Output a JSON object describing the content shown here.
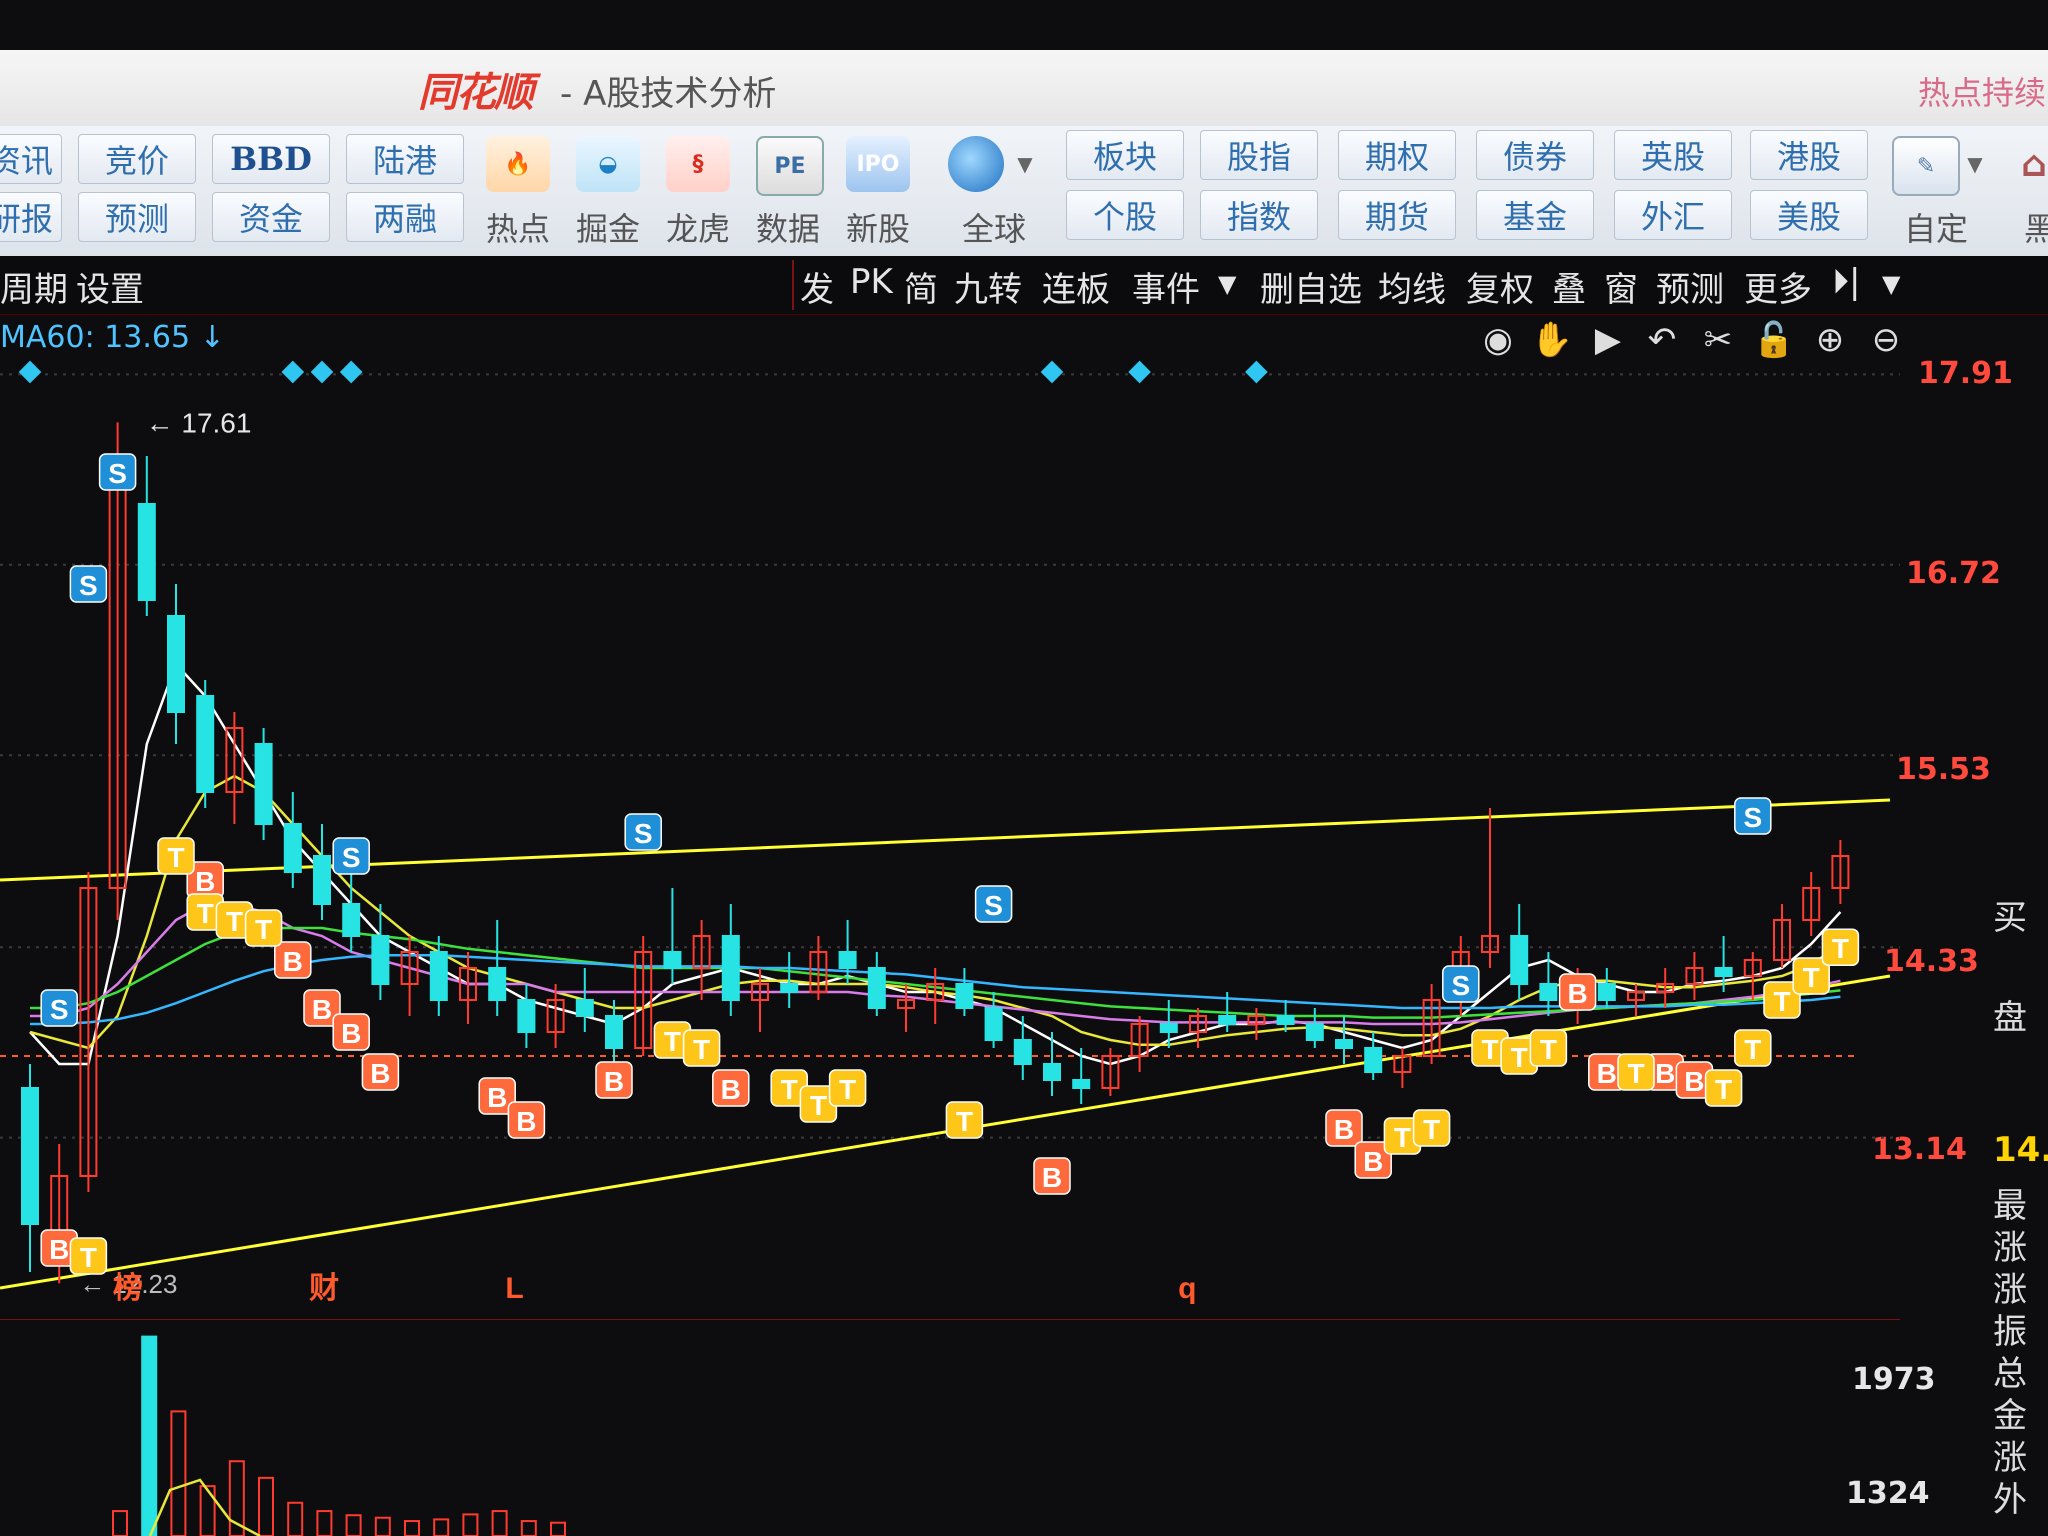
{
  "window": {
    "app_name": "同花顺",
    "title": "- A股技术分析",
    "hot_text": "热点持续"
  },
  "toolbar": {
    "top_row": [
      "资讯",
      "竞价",
      "BBD",
      "陆港"
    ],
    "bottom_row": [
      "研报",
      "预测",
      "资金",
      "两融"
    ],
    "icons": [
      {
        "label": "热点",
        "icon": "flame-icon"
      },
      {
        "label": "掘金",
        "icon": "gold-basket-icon"
      },
      {
        "label": "龙虎",
        "icon": "dragon-icon"
      },
      {
        "label": "数据",
        "icon": "pe-icon"
      },
      {
        "label": "新股",
        "icon": "ipo-icon"
      },
      {
        "label": "全球",
        "icon": "globe-icon"
      }
    ],
    "market_top": [
      "板块",
      "股指",
      "期权",
      "债券",
      "英股",
      "港股"
    ],
    "market_bottom": [
      "个股",
      "指数",
      "期货",
      "基金",
      "外汇",
      "美股"
    ],
    "custom_label": "自定",
    "more_label": "黑"
  },
  "chart_toolbar": {
    "left": [
      "周期",
      "设置"
    ],
    "right": [
      "发",
      "PK",
      "简",
      "九转",
      "连板",
      "事件",
      "删自选",
      "均线",
      "复权",
      "叠",
      "窗",
      "预测",
      "更多"
    ]
  },
  "ma_readout": "MA60: 13.65",
  "price_axis": [
    "17.91",
    "16.72",
    "15.53",
    "14.33",
    "13.14"
  ],
  "volume_axis": [
    "1973",
    "1324"
  ],
  "annotations": {
    "high": "17.61",
    "low": "12.23",
    "events": [
      "榜",
      "财",
      "L",
      "q"
    ]
  },
  "right_panel": {
    "labels": [
      "买",
      "盘",
      "14.",
      "最",
      "涨",
      "涨",
      "振",
      "总",
      "金",
      "涨",
      "外"
    ]
  },
  "colors": {
    "up": "#ff3b2f",
    "down": "#27e3e3",
    "trend_line": "#ffff33",
    "ma_white": "#ffffff",
    "ma_yellow": "#e8e83a",
    "ma_purple": "#d77ce8",
    "ma_green": "#3ee03e",
    "ma_blue": "#35b7ff",
    "b_marker": "#ff6a3d",
    "t_marker": "#ffc61a",
    "s_marker": "#1f8fd8"
  },
  "chart_data": {
    "type": "candlestick",
    "ylim": [
      12.0,
      18.0
    ],
    "candles": [
      [
        13.45,
        13.6,
        12.3,
        12.6
      ],
      [
        12.55,
        13.1,
        12.23,
        12.9
      ],
      [
        12.9,
        14.8,
        12.8,
        14.7
      ],
      [
        14.7,
        17.61,
        14.5,
        17.2
      ],
      [
        17.1,
        17.4,
        16.4,
        16.5
      ],
      [
        16.4,
        16.6,
        15.6,
        15.8
      ],
      [
        15.9,
        16.0,
        15.2,
        15.3
      ],
      [
        15.3,
        15.8,
        15.1,
        15.7
      ],
      [
        15.6,
        15.7,
        15.0,
        15.1
      ],
      [
        15.1,
        15.3,
        14.7,
        14.8
      ],
      [
        14.9,
        15.1,
        14.5,
        14.6
      ],
      [
        14.6,
        14.8,
        14.3,
        14.4
      ],
      [
        14.4,
        14.6,
        14.0,
        14.1
      ],
      [
        14.1,
        14.4,
        13.9,
        14.3
      ],
      [
        14.3,
        14.4,
        13.9,
        14.0
      ],
      [
        14.0,
        14.3,
        13.85,
        14.2
      ],
      [
        14.2,
        14.5,
        13.9,
        14.0
      ],
      [
        14.0,
        14.1,
        13.7,
        13.8
      ],
      [
        13.8,
        14.1,
        13.7,
        14.0
      ],
      [
        14.0,
        14.2,
        13.8,
        13.9
      ],
      [
        13.9,
        14.0,
        13.6,
        13.7
      ],
      [
        13.7,
        14.4,
        13.65,
        14.3
      ],
      [
        14.3,
        14.7,
        14.1,
        14.2
      ],
      [
        14.2,
        14.5,
        14.0,
        14.4
      ],
      [
        14.4,
        14.6,
        13.9,
        14.0
      ],
      [
        14.0,
        14.2,
        13.8,
        14.1
      ],
      [
        14.1,
        14.3,
        13.95,
        14.05
      ],
      [
        14.05,
        14.4,
        14.0,
        14.3
      ],
      [
        14.3,
        14.5,
        14.1,
        14.2
      ],
      [
        14.2,
        14.3,
        13.9,
        13.95
      ],
      [
        13.95,
        14.1,
        13.8,
        14.0
      ],
      [
        14.0,
        14.2,
        13.85,
        14.1
      ],
      [
        14.1,
        14.2,
        13.9,
        13.95
      ],
      [
        13.95,
        14.05,
        13.7,
        13.75
      ],
      [
        13.75,
        13.9,
        13.5,
        13.6
      ],
      [
        13.6,
        13.8,
        13.4,
        13.5
      ],
      [
        13.5,
        13.7,
        13.35,
        13.45
      ],
      [
        13.45,
        13.7,
        13.4,
        13.65
      ],
      [
        13.65,
        13.9,
        13.55,
        13.85
      ],
      [
        13.85,
        14.0,
        13.7,
        13.8
      ],
      [
        13.8,
        13.95,
        13.7,
        13.9
      ],
      [
        13.9,
        14.05,
        13.8,
        13.85
      ],
      [
        13.85,
        13.95,
        13.75,
        13.9
      ],
      [
        13.9,
        14.0,
        13.8,
        13.85
      ],
      [
        13.85,
        13.95,
        13.7,
        13.75
      ],
      [
        13.75,
        13.9,
        13.6,
        13.7
      ],
      [
        13.7,
        13.8,
        13.5,
        13.55
      ],
      [
        13.55,
        13.7,
        13.45,
        13.65
      ],
      [
        13.65,
        14.1,
        13.6,
        14.0
      ],
      [
        14.0,
        14.4,
        13.9,
        14.3
      ],
      [
        14.3,
        15.2,
        14.2,
        14.4
      ],
      [
        14.4,
        14.6,
        14.0,
        14.1
      ],
      [
        14.1,
        14.3,
        13.9,
        14.0
      ],
      [
        14.0,
        14.2,
        13.85,
        14.1
      ],
      [
        14.1,
        14.2,
        13.95,
        14.0
      ],
      [
        14.0,
        14.1,
        13.9,
        14.05
      ],
      [
        14.05,
        14.2,
        13.95,
        14.1
      ],
      [
        14.1,
        14.3,
        14.0,
        14.2
      ],
      [
        14.2,
        14.4,
        14.05,
        14.15
      ],
      [
        14.15,
        14.3,
        14.0,
        14.25
      ],
      [
        14.25,
        14.6,
        14.2,
        14.5
      ],
      [
        14.5,
        14.8,
        14.4,
        14.7
      ],
      [
        14.7,
        15.0,
        14.6,
        14.9
      ]
    ],
    "ma_series": [
      {
        "values": [
          13.8,
          13.6,
          13.6,
          14.4,
          15.6,
          16.1,
          15.9,
          15.6,
          15.3,
          15.0,
          14.8,
          14.6,
          14.4,
          14.3,
          14.2,
          14.1,
          14.1,
          14.0,
          13.95,
          13.9,
          13.85,
          13.95,
          14.1,
          14.15,
          14.2,
          14.15,
          14.1,
          14.1,
          14.15,
          14.1,
          14.05,
          14.05,
          14.0,
          13.95,
          13.85,
          13.75,
          13.65,
          13.6,
          13.65,
          13.75,
          13.8,
          13.85,
          13.85,
          13.87,
          13.85,
          13.8,
          13.75,
          13.7,
          13.75,
          13.9,
          14.05,
          14.2,
          14.25,
          14.15,
          14.1,
          14.05,
          14.05,
          14.1,
          14.12,
          14.15,
          14.2,
          14.35,
          14.55
        ]
      },
      {
        "values": [
          13.8,
          13.75,
          13.7,
          13.9,
          14.4,
          15.0,
          15.3,
          15.4,
          15.3,
          15.1,
          14.9,
          14.7,
          14.55,
          14.4,
          14.3,
          14.2,
          14.15,
          14.1,
          14.05,
          14.0,
          13.95,
          13.95,
          14.0,
          14.05,
          14.1,
          14.12,
          14.12,
          14.1,
          14.1,
          14.1,
          14.08,
          14.05,
          14.03,
          14.0,
          13.95,
          13.9,
          13.8,
          13.75,
          13.72,
          13.72,
          13.75,
          13.78,
          13.8,
          13.82,
          13.83,
          13.82,
          13.8,
          13.78,
          13.78,
          13.82,
          13.9,
          14.0,
          14.08,
          14.12,
          14.12,
          14.1,
          14.08,
          14.08,
          14.1,
          14.12,
          14.15,
          14.22,
          14.35
        ]
      },
      {
        "values": [
          13.9,
          13.9,
          13.95,
          14.1,
          14.3,
          14.5,
          14.6,
          14.6,
          14.55,
          14.45,
          14.4,
          14.3,
          14.25,
          14.2,
          14.15,
          14.1,
          14.1,
          14.1,
          14.05,
          14.05,
          14.05,
          14.05,
          14.05,
          14.05,
          14.05,
          14.05,
          14.05,
          14.05,
          14.05,
          14.03,
          14.02,
          14.0,
          13.98,
          13.96,
          13.94,
          13.92,
          13.9,
          13.88,
          13.87,
          13.86,
          13.86,
          13.86,
          13.86,
          13.86,
          13.86,
          13.86,
          13.85,
          13.85,
          13.85,
          13.86,
          13.88,
          13.9,
          13.92,
          13.94,
          13.95,
          13.96,
          13.97,
          13.98,
          14.0,
          14.02,
          14.05,
          14.08,
          14.12
        ]
      },
      {
        "values": [
          13.95,
          13.95,
          13.98,
          14.05,
          14.15,
          14.25,
          14.35,
          14.42,
          14.45,
          14.45,
          14.45,
          14.42,
          14.4,
          14.38,
          14.35,
          14.32,
          14.3,
          14.28,
          14.26,
          14.24,
          14.22,
          14.2,
          14.2,
          14.2,
          14.2,
          14.2,
          14.18,
          14.16,
          14.14,
          14.12,
          14.1,
          14.08,
          14.06,
          14.04,
          14.02,
          14.0,
          13.98,
          13.96,
          13.95,
          13.94,
          13.93,
          13.92,
          13.91,
          13.9,
          13.9,
          13.9,
          13.89,
          13.89,
          13.89,
          13.9,
          13.91,
          13.92,
          13.93,
          13.94,
          13.95,
          13.96,
          13.97,
          13.98,
          13.99,
          14.0,
          14.02,
          14.04,
          14.06
        ]
      },
      {
        "values": [
          13.85,
          13.85,
          13.86,
          13.88,
          13.92,
          13.98,
          14.05,
          14.12,
          14.18,
          14.22,
          14.25,
          14.27,
          14.28,
          14.28,
          14.28,
          14.27,
          14.26,
          14.25,
          14.24,
          14.23,
          14.22,
          14.21,
          14.21,
          14.21,
          14.21,
          14.2,
          14.2,
          14.19,
          14.18,
          14.17,
          14.16,
          14.14,
          14.12,
          14.1,
          14.08,
          14.07,
          14.06,
          14.05,
          14.04,
          14.03,
          14.02,
          14.01,
          14.0,
          13.99,
          13.98,
          13.97,
          13.96,
          13.95,
          13.95,
          13.95,
          13.95,
          13.96,
          13.96,
          13.96,
          13.96,
          13.96,
          13.96,
          13.97,
          13.97,
          13.98,
          13.99,
          14.0,
          14.02
        ]
      }
    ],
    "trend_lines": [
      {
        "from": [
          0,
          14.75
        ],
        "to": [
          62,
          15.25
        ]
      },
      {
        "from": [
          0,
          12.2
        ],
        "to": [
          62,
          14.15
        ]
      }
    ],
    "signals": [
      {
        "type": "S",
        "i": 3,
        "price": 17.3
      },
      {
        "type": "S",
        "i": 2,
        "price": 16.6
      },
      {
        "type": "S",
        "i": 1,
        "price": 13.95
      },
      {
        "type": "S",
        "i": 11,
        "price": 14.9
      },
      {
        "type": "S",
        "i": 21,
        "price": 15.05
      },
      {
        "type": "S",
        "i": 33,
        "price": 14.6
      },
      {
        "type": "S",
        "i": 49,
        "price": 14.1
      },
      {
        "type": "S",
        "i": 59,
        "price": 15.15
      },
      {
        "type": "B",
        "i": 1,
        "price": 12.45
      },
      {
        "type": "B",
        "i": 6,
        "price": 14.75
      },
      {
        "type": "B",
        "i": 9,
        "price": 14.25
      },
      {
        "type": "B",
        "i": 10,
        "price": 13.95
      },
      {
        "type": "B",
        "i": 11,
        "price": 13.8
      },
      {
        "type": "B",
        "i": 12,
        "price": 13.55
      },
      {
        "type": "B",
        "i": 16,
        "price": 13.4
      },
      {
        "type": "B",
        "i": 17,
        "price": 13.25
      },
      {
        "type": "B",
        "i": 20,
        "price": 13.5
      },
      {
        "type": "B",
        "i": 24,
        "price": 13.45
      },
      {
        "type": "B",
        "i": 35,
        "price": 12.9
      },
      {
        "type": "B",
        "i": 45,
        "price": 13.2
      },
      {
        "type": "B",
        "i": 46,
        "price": 13.0
      },
      {
        "type": "B",
        "i": 53,
        "price": 14.05
      },
      {
        "type": "B",
        "i": 54,
        "price": 13.55
      },
      {
        "type": "B",
        "i": 56,
        "price": 13.55
      },
      {
        "type": "B",
        "i": 57,
        "price": 13.5
      },
      {
        "type": "T",
        "i": 2,
        "price": 12.4
      },
      {
        "type": "T",
        "i": 5,
        "price": 14.9
      },
      {
        "type": "T",
        "i": 6,
        "price": 14.55
      },
      {
        "type": "T",
        "i": 7,
        "price": 14.5
      },
      {
        "type": "T",
        "i": 8,
        "price": 14.45
      },
      {
        "type": "T",
        "i": 22,
        "price": 13.75
      },
      {
        "type": "T",
        "i": 23,
        "price": 13.7
      },
      {
        "type": "T",
        "i": 26,
        "price": 13.45
      },
      {
        "type": "T",
        "i": 27,
        "price": 13.35
      },
      {
        "type": "T",
        "i": 28,
        "price": 13.45
      },
      {
        "type": "T",
        "i": 32,
        "price": 13.25
      },
      {
        "type": "T",
        "i": 47,
        "price": 13.15
      },
      {
        "type": "T",
        "i": 48,
        "price": 13.2
      },
      {
        "type": "T",
        "i": 50,
        "price": 13.7
      },
      {
        "type": "T",
        "i": 51,
        "price": 13.65
      },
      {
        "type": "T",
        "i": 52,
        "price": 13.7
      },
      {
        "type": "T",
        "i": 55,
        "price": 13.55
      },
      {
        "type": "T",
        "i": 58,
        "price": 13.45
      },
      {
        "type": "T",
        "i": 59,
        "price": 13.7
      },
      {
        "type": "T",
        "i": 60,
        "price": 14.0
      },
      {
        "type": "T",
        "i": 61,
        "price": 14.15
      },
      {
        "type": "T",
        "i": 62,
        "price": 14.33
      }
    ],
    "top_markers": [
      0,
      9,
      10,
      11,
      35,
      38,
      42
    ],
    "event_marks": [
      {
        "i": 3,
        "text": "榜"
      },
      {
        "i": 10,
        "text": "财"
      },
      {
        "i": 17,
        "text": "L"
      },
      {
        "i": 41,
        "text": "q"
      }
    ],
    "volume": {
      "ylim": [
        0,
        2600
      ],
      "values": [
        300,
        2400,
        1500,
        600,
        900,
        700,
        400,
        300,
        250,
        220,
        180,
        200,
        260,
        300,
        180,
        160
      ]
    }
  }
}
